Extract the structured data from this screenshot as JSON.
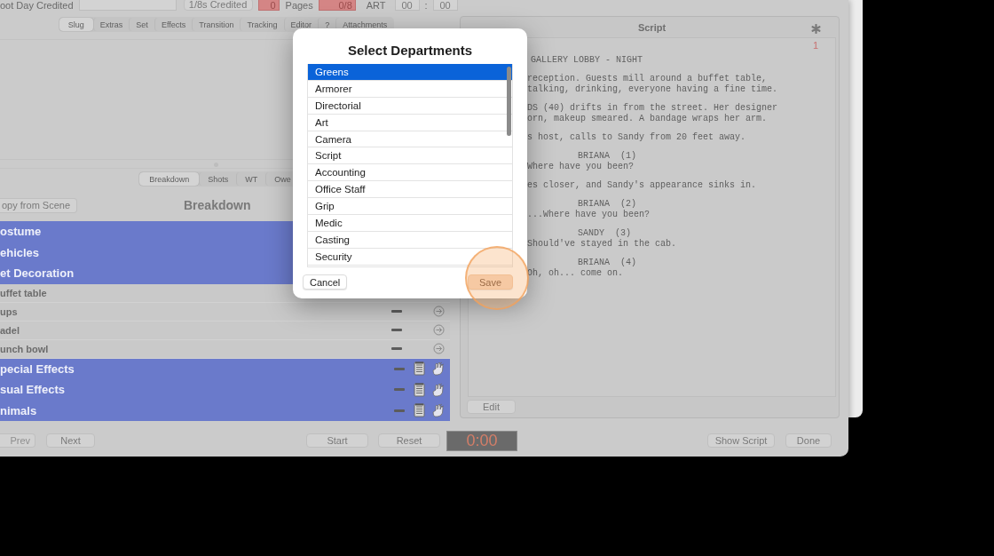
{
  "top_row": {
    "shoot_day_label": "oot Day Credited",
    "credited_button": "1/8s Credited",
    "eighths_field": "0",
    "pages_label": "Pages",
    "pages_field": "0/8",
    "art_label": "ART",
    "art_hours": "00",
    "art_separator": ":",
    "art_minutes": "00"
  },
  "upper_tabs": [
    {
      "label": "Slug",
      "selected": true
    },
    {
      "label": "Extras",
      "selected": false
    },
    {
      "label": "Set",
      "selected": false
    },
    {
      "label": "Effects",
      "selected": false
    },
    {
      "label": "Transition",
      "selected": false
    },
    {
      "label": "Tracking",
      "selected": false
    },
    {
      "label": "Editor",
      "selected": false
    },
    {
      "label": "?",
      "selected": false
    },
    {
      "label": "Attachments",
      "selected": false
    }
  ],
  "lower_tabs": [
    {
      "label": "Breakdown",
      "selected": true
    },
    {
      "label": "Shots",
      "selected": false
    },
    {
      "label": "WT",
      "selected": false
    },
    {
      "label": "Owe",
      "selected": false
    }
  ],
  "copy_button": "opy from Scene",
  "breakdown_title": "Breakdown",
  "breakdown_rows": [
    {
      "kind": "category",
      "label": "ostume"
    },
    {
      "kind": "category",
      "label": "ehicles"
    },
    {
      "kind": "category",
      "label": "et Decoration"
    },
    {
      "kind": "item",
      "label": "uffet table"
    },
    {
      "kind": "item_with_tools",
      "label": "ups"
    },
    {
      "kind": "item_with_tools",
      "label": "adel"
    },
    {
      "kind": "item_with_tools",
      "label": "unch bowl"
    },
    {
      "kind": "category_with_tools",
      "label": "pecial Effects"
    },
    {
      "kind": "category_with_tools",
      "label": "sual Effects"
    },
    {
      "kind": "category_with_tools",
      "label": "nimals"
    }
  ],
  "script": {
    "title": "Script",
    "page_number": "1",
    "blocks": [
      {
        "kind": "slug",
        "lines": [
          "GALLERY LOBBY - NIGHT"
        ]
      },
      {
        "kind": "action",
        "lines": [
          "reception. Guests mill around a buffet table,",
          "talking, drinking, everyone having a fine time."
        ]
      },
      {
        "kind": "action",
        "lines": [
          "DS (40) drifts in from the street. Her designer",
          "orn, makeup smeared. A bandage wraps her arm."
        ]
      },
      {
        "kind": "action",
        "lines": [
          "s host, calls to Sandy from 20 feet away."
        ]
      },
      {
        "kind": "character",
        "lines": [
          "BRIANA  (1)"
        ]
      },
      {
        "kind": "dialogue",
        "lines": [
          "Where have you been?"
        ]
      },
      {
        "kind": "action",
        "lines": [
          "es closer, and Sandy's appearance sinks in."
        ]
      },
      {
        "kind": "character",
        "lines": [
          "BRIANA  (2)"
        ]
      },
      {
        "kind": "dialogue",
        "lines": [
          "...Where have you been?"
        ]
      },
      {
        "kind": "character",
        "lines": [
          "SANDY  (3)"
        ]
      },
      {
        "kind": "dialogue",
        "lines": [
          "Should've stayed in the cab."
        ]
      },
      {
        "kind": "character",
        "lines": [
          "BRIANA  (4)"
        ]
      },
      {
        "kind": "dialogue",
        "lines": [
          "Oh, oh... come on."
        ]
      }
    ],
    "edit_button": "Edit"
  },
  "bottom_bar": {
    "prev": {
      "label": "Prev",
      "disabled": true
    },
    "next": {
      "label": "Next",
      "disabled": false
    },
    "start": "Start",
    "reset": "Reset",
    "timer": "0:00",
    "show_script": "Show Script",
    "done": "Done"
  },
  "dialog": {
    "title": "Select Departments",
    "departments": [
      {
        "label": "Greens",
        "selected": true
      },
      {
        "label": "Armorer",
        "selected": false
      },
      {
        "label": "Directorial",
        "selected": false
      },
      {
        "label": "Art",
        "selected": false
      },
      {
        "label": "Camera",
        "selected": false
      },
      {
        "label": "Script",
        "selected": false
      },
      {
        "label": "Accounting",
        "selected": false
      },
      {
        "label": "Office Staff",
        "selected": false
      },
      {
        "label": "Grip",
        "selected": false
      },
      {
        "label": "Medic",
        "selected": false
      },
      {
        "label": "Casting",
        "selected": false
      },
      {
        "label": "Security",
        "selected": false
      }
    ],
    "cancel": "Cancel",
    "save": "Save"
  }
}
